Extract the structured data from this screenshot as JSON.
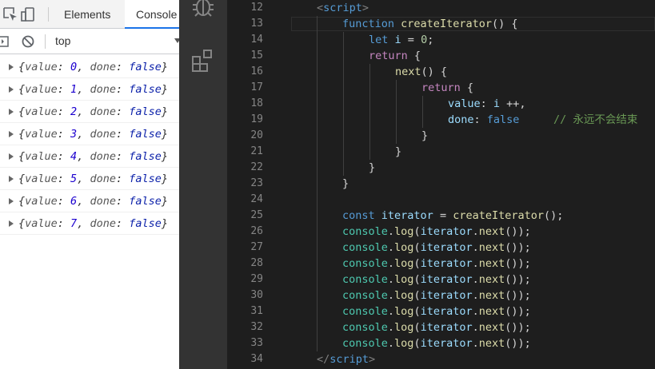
{
  "devtools": {
    "tabs": {
      "elements": "Elements",
      "console": "Console"
    },
    "toolbar": {
      "context": "top"
    },
    "console_messages": [
      {
        "key_value": "value",
        "value": "0",
        "key_done": "done",
        "done": "false"
      },
      {
        "key_value": "value",
        "value": "1",
        "key_done": "done",
        "done": "false"
      },
      {
        "key_value": "value",
        "value": "2",
        "key_done": "done",
        "done": "false"
      },
      {
        "key_value": "value",
        "value": "3",
        "key_done": "done",
        "done": "false"
      },
      {
        "key_value": "value",
        "value": "4",
        "key_done": "done",
        "done": "false"
      },
      {
        "key_value": "value",
        "value": "5",
        "key_done": "done",
        "done": "false"
      },
      {
        "key_value": "value",
        "value": "6",
        "key_done": "done",
        "done": "false"
      },
      {
        "key_value": "value",
        "value": "7",
        "key_done": "done",
        "done": "false"
      }
    ]
  },
  "activity_bar": {
    "icons": [
      "debug-icon",
      "extensions-icon"
    ]
  },
  "editor": {
    "line_numbers": [
      "12",
      "13",
      "14",
      "15",
      "16",
      "17",
      "18",
      "19",
      "20",
      "21",
      "22",
      "23",
      "24",
      "25",
      "26",
      "27",
      "28",
      "29",
      "30",
      "31",
      "32",
      "33",
      "34"
    ],
    "code": {
      "l12": {
        "open": "<",
        "tag": "script",
        "close": ">"
      },
      "l13": {
        "kw": "function",
        "name": "createIterator",
        "rest": "() {"
      },
      "l14": {
        "kw": "let",
        "var": "i",
        "eq": " = ",
        "num": "0",
        "semi": ";"
      },
      "l15": {
        "kw": "return",
        "brace": " {"
      },
      "l16": {
        "fn": "next",
        "rest": "() {"
      },
      "l17": {
        "kw": "return",
        "brace": " {"
      },
      "l18": {
        "prop": "value",
        "colon": ": ",
        "var": "i",
        "rest": " ++,"
      },
      "l19": {
        "prop": "done",
        "colon": ": ",
        "val": "false",
        "comment": "// 永远不会结束"
      },
      "l20": {
        "text": "}"
      },
      "l21": {
        "text": "}"
      },
      "l22": {
        "text": "}"
      },
      "l23": {
        "text": "}"
      },
      "l25": {
        "kw": "const",
        "var": "iterator",
        "eq": " = ",
        "fn": "createIterator",
        "rest": "();"
      },
      "log_line": {
        "obj": "console",
        "dot": ".",
        "method": "log",
        "p1": "(",
        "arg": "iterator",
        "dot2": ".",
        "call": "next",
        "p2": "());"
      },
      "l34": {
        "open": "</",
        "tag": "script",
        "close": ">"
      }
    }
  },
  "colors": {
    "editor_bg": "#1e1e1e",
    "activity_bar_bg": "#333333",
    "keyword": "#569cd6",
    "control": "#c586c0",
    "function": "#dcdcaa",
    "variable": "#9cdcfe",
    "number": "#b5cea8",
    "comment": "#6a9955",
    "class": "#4ec9b0",
    "console_tab_accent": "#1a73e8"
  }
}
